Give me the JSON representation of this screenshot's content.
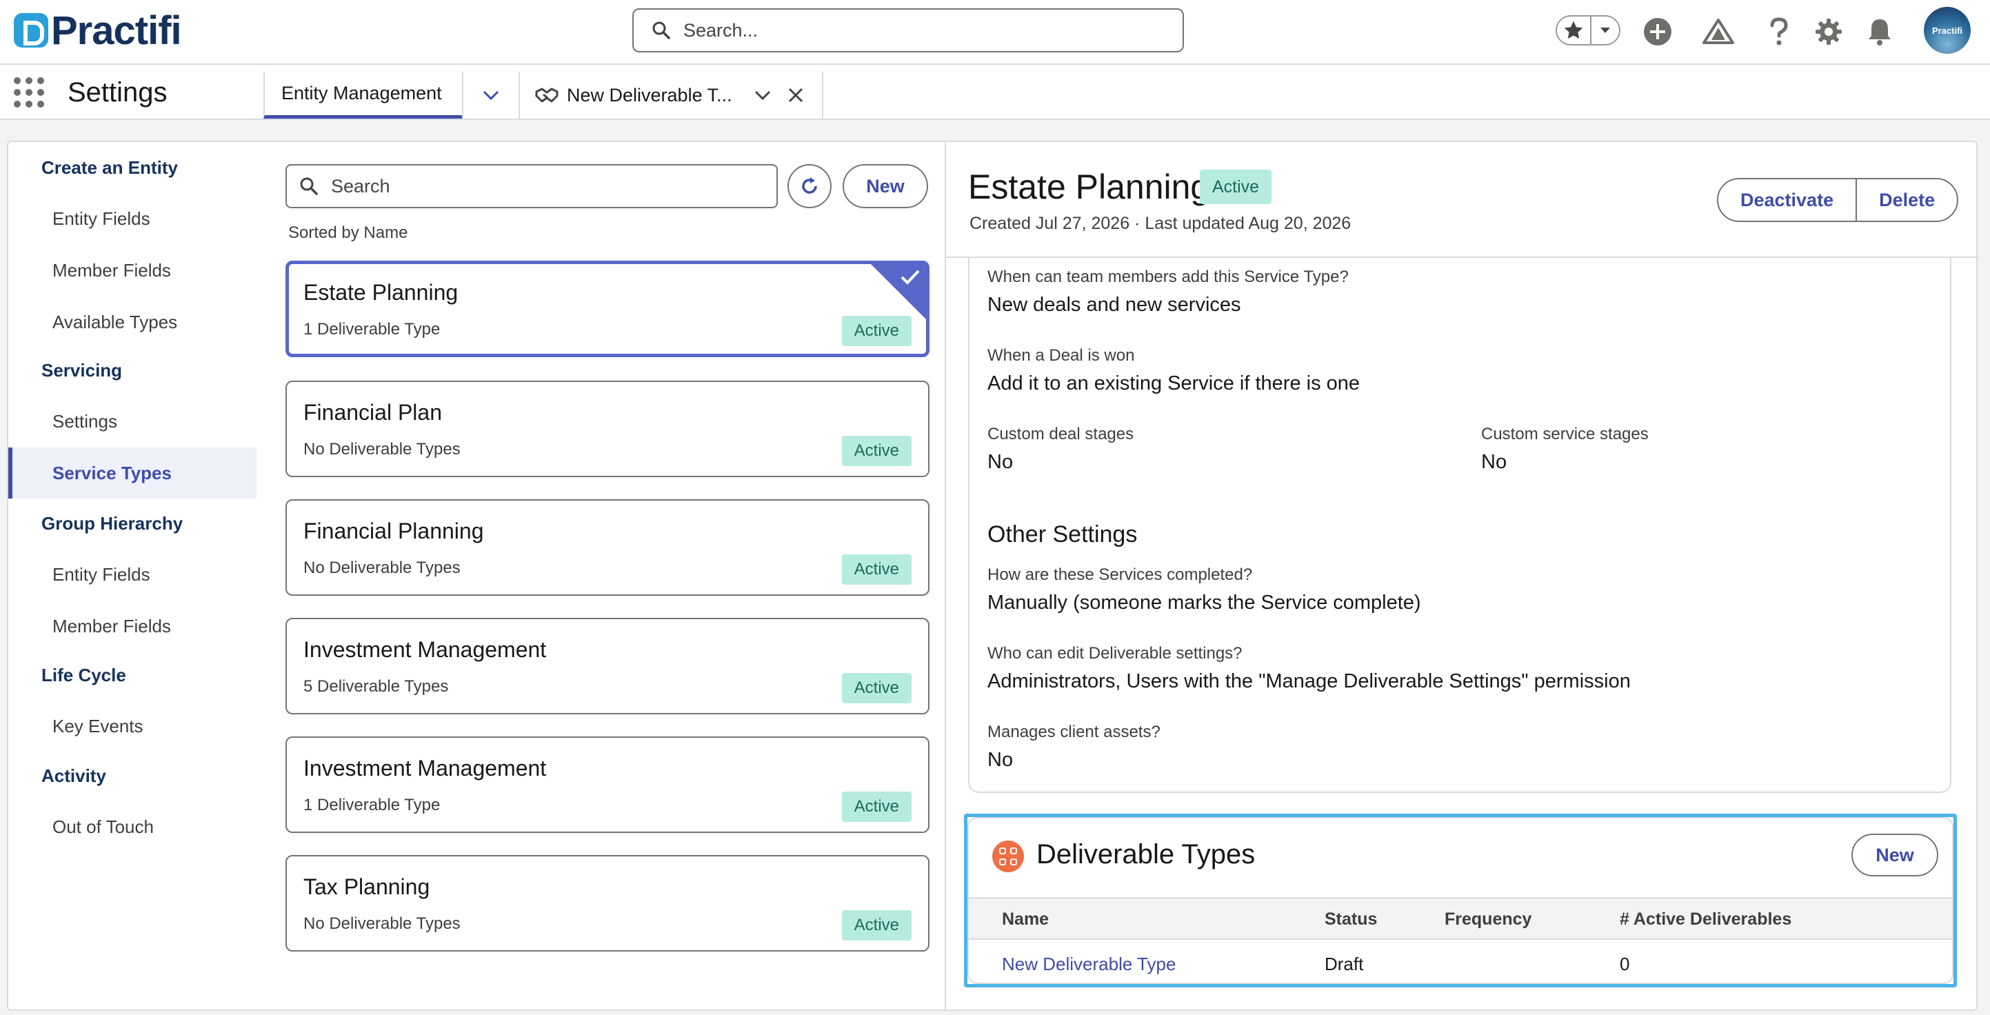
{
  "header": {
    "logo_text": "Practifi",
    "search_placeholder": "Search...",
    "avatar_text": "Practifi"
  },
  "navbar": {
    "app_name": "Settings",
    "tabs": [
      {
        "label": "Entity Management"
      },
      {
        "label": "New Deliverable T..."
      }
    ]
  },
  "sidebar": {
    "sections": [
      {
        "label": "Create an Entity",
        "items": [
          "Entity Fields",
          "Member Fields",
          "Available Types"
        ]
      },
      {
        "label": "Servicing",
        "items": [
          "Settings",
          "Service Types"
        ]
      },
      {
        "label": "Group Hierarchy",
        "items": [
          "Entity Fields",
          "Member Fields"
        ]
      },
      {
        "label": "Life Cycle",
        "items": [
          "Key Events"
        ]
      },
      {
        "label": "Activity",
        "items": [
          "Out of Touch"
        ]
      }
    ],
    "active_item": "Service Types"
  },
  "list": {
    "search_placeholder": "Search",
    "new_label": "New",
    "sorted_label": "Sorted by Name",
    "cards": [
      {
        "title": "Estate Planning",
        "sub": "1 Deliverable Type",
        "status": "Active"
      },
      {
        "title": "Financial Plan",
        "sub": "No Deliverable Types",
        "status": "Active"
      },
      {
        "title": "Financial Planning",
        "sub": "No Deliverable Types",
        "status": "Active"
      },
      {
        "title": "Investment Management",
        "sub": "5 Deliverable Types",
        "status": "Active"
      },
      {
        "title": "Investment Management",
        "sub": "1 Deliverable Type",
        "status": "Active"
      },
      {
        "title": "Tax Planning",
        "sub": "No Deliverable Types",
        "status": "Active"
      }
    ]
  },
  "detail": {
    "title": "Estate Planning",
    "status": "Active",
    "meta": "Created Jul 27, 2026  ·  Last updated Aug 20, 2026",
    "deactivate_label": "Deactivate",
    "delete_label": "Delete",
    "fields": {
      "when_add_label": "When can team members add this Service Type?",
      "when_add_value": "New deals and new services",
      "deal_won_label": "When a Deal is won",
      "deal_won_value": "Add it to an existing Service if there is one",
      "custom_deal_label": "Custom deal stages",
      "custom_deal_value": "No",
      "custom_service_label": "Custom service stages",
      "custom_service_value": "No",
      "other_heading": "Other Settings",
      "completed_label": "How are these Services completed?",
      "completed_value": "Manually (someone marks the Service complete)",
      "edit_label": "Who can edit Deliverable settings?",
      "edit_value": "Administrators, Users with the \"Manage Deliverable Settings\" permission",
      "assets_label": "Manages client assets?",
      "assets_value": "No"
    },
    "deliverable_types": {
      "title": "Deliverable Types",
      "new_label": "New",
      "columns": [
        "Name",
        "Status",
        "Frequency",
        "# Active Deliverables"
      ],
      "rows": [
        {
          "name": "New Deliverable Type",
          "status": "Draft",
          "frequency": "",
          "active": "0"
        }
      ]
    }
  },
  "colors": {
    "brand_navy": "#16325c",
    "accent_indigo": "#3e4ca8",
    "selected_border": "#5867c9",
    "badge_green_bg": "#b6ecdf",
    "highlight_blue": "#4bb3e6",
    "deliverable_icon": "#ef6e44"
  },
  "icons": [
    "search-icon",
    "star-icon",
    "chevron-down-icon",
    "plus-circle-icon",
    "trailhead-icon",
    "help-icon",
    "gear-icon",
    "bell-icon",
    "waffle-icon",
    "handshake-icon",
    "close-icon",
    "refresh-icon",
    "checkmark-icon",
    "deliverable-icon"
  ]
}
